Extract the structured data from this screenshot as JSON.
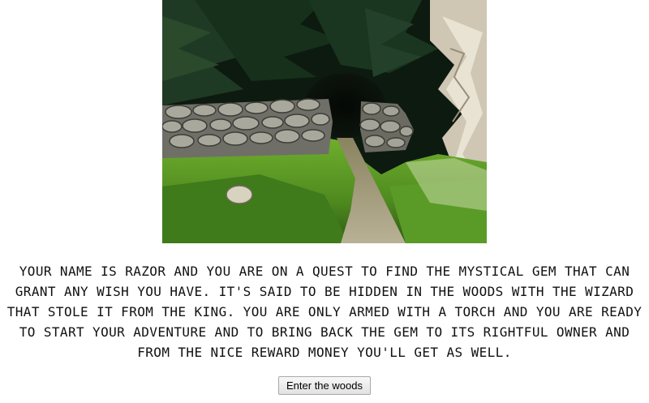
{
  "story": {
    "text": "Your name is Razor and you are on a quest to find the mystical gem that can grant any wish you have. It's said to be hidden in the woods with the wizard that stole it from the king. You are only armed with a torch and you are ready to start your adventure and to bring back the gem to its rightful owner and from the nice reward money you'll get as well."
  },
  "actions": {
    "enter_label": "Enter the woods"
  }
}
